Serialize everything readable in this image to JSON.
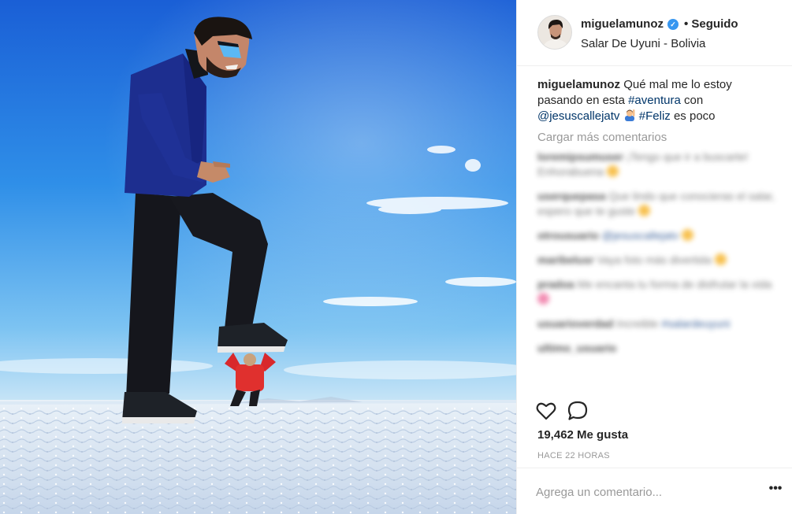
{
  "post": {
    "username": "miguelamunoz",
    "follow_status": "• Seguido",
    "location": "Salar De Uyuni - Bolivia",
    "verified_icon": "verified-badge-icon",
    "caption": {
      "author": "miguelamunoz",
      "text_1": "Qué mal me lo estoy pasando en esta ",
      "hashtag_1": "#aventura",
      "text_2": " con ",
      "mention": "@jesuscallejatv",
      "emoji": "man-raising-hand-emoji",
      "hashtag_2": "#Feliz",
      "text_3": " es poco"
    },
    "load_more_comments": "Cargar más comentarios",
    "blurred_comments": [
      {
        "user": "loremipsumuser",
        "text": "¡Tengo que ir a buscarte! Enhorabuena",
        "emoji": true,
        "link": ""
      },
      {
        "user": "userquepasa",
        "text": "Que lindo que conocieras el salar, espero que te guste",
        "emoji": true,
        "link": ""
      },
      {
        "user": "otrousuario",
        "text": "",
        "emoji": true,
        "link": "@jesuscallejatv"
      },
      {
        "user": "maribelusr",
        "text": "Vaya foto más divertida",
        "emoji": true,
        "link": ""
      },
      {
        "user": "pradoa",
        "text": "Me encanta tu forma de disfrutar la vida",
        "emoji": true,
        "link": ""
      },
      {
        "user": "usuarioverdad",
        "text": "Increible",
        "emoji": false,
        "link": "#salardeuyuni"
      },
      {
        "user": "ultimo_usuario",
        "text": "",
        "emoji": false,
        "link": ""
      }
    ],
    "likes": "19,462 Me gusta",
    "timestamp": "HACE 22 HORAS",
    "comment_placeholder": "Agrega un comentario...",
    "more_options": "•••",
    "icons": {
      "like": "heart-outline-icon",
      "comment": "speech-bubble-icon",
      "more": "more-options-icon"
    },
    "colors": {
      "text": "#262626",
      "muted": "#999999",
      "link": "#003569",
      "verified": "#3897f0",
      "sky_top": "#1d6fe0",
      "sky_bottom": "#79c1f2"
    }
  }
}
